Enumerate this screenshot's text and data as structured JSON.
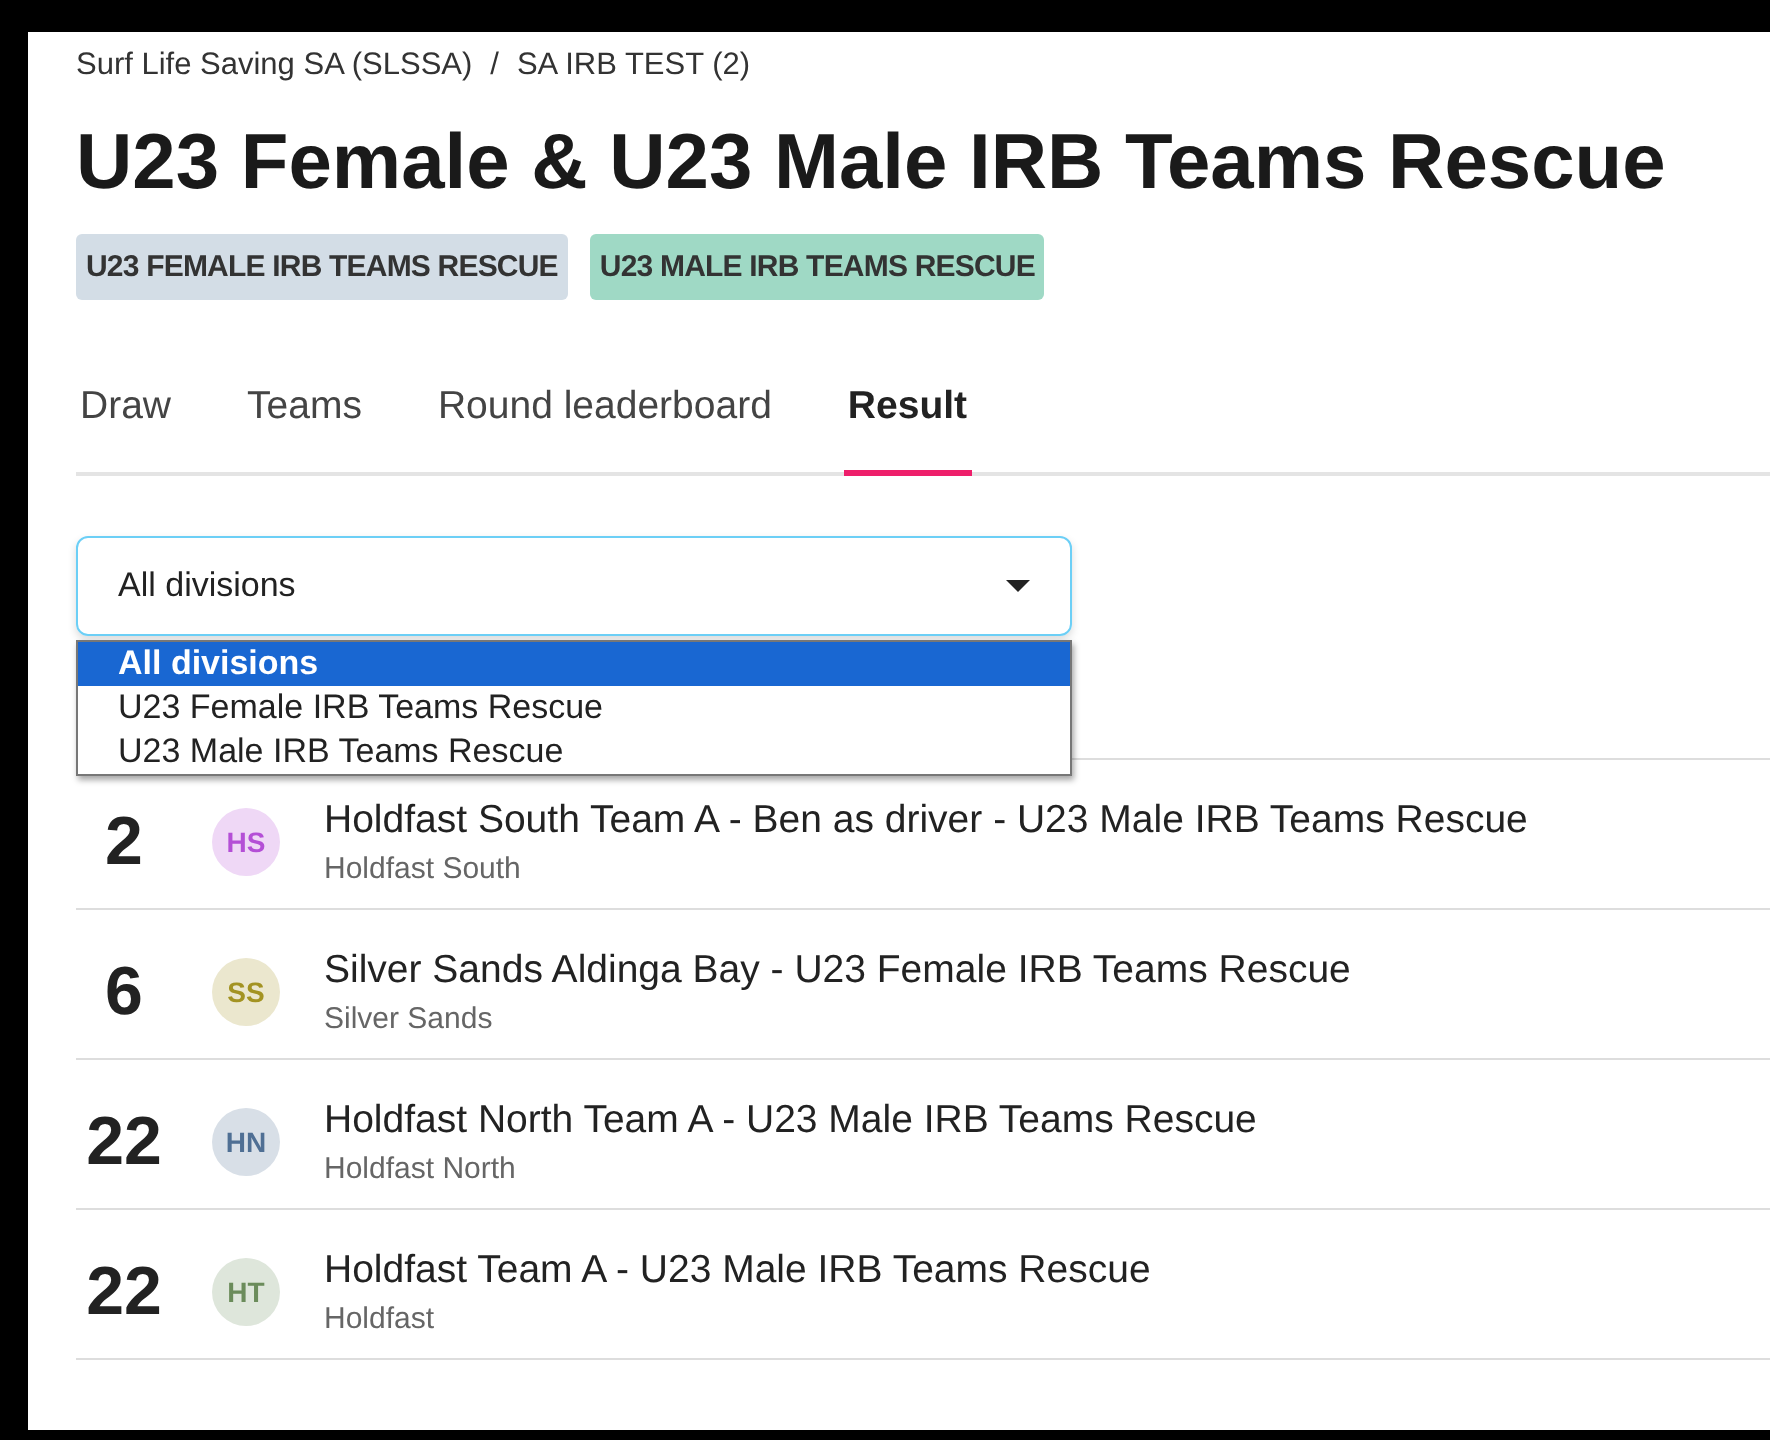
{
  "breadcrumb": [
    "Surf Life Saving SA (SLSSA)",
    "SA IRB TEST (2)"
  ],
  "breadcrumb_separator": "/",
  "title": "U23 Female & U23 Male IRB Teams Rescue",
  "chips": [
    {
      "label": "U23 FEMALE IRB TEAMS RESCUE",
      "color": "#d3dde6"
    },
    {
      "label": "U23 MALE IRB TEAMS RESCUE",
      "color": "#9fd9c5"
    }
  ],
  "tabs": [
    {
      "label": "Draw",
      "selected": false
    },
    {
      "label": "Teams",
      "selected": false
    },
    {
      "label": "Round leaderboard",
      "selected": false
    },
    {
      "label": "Result",
      "selected": true
    }
  ],
  "division_select": {
    "value": "All divisions",
    "expanded": true,
    "options": [
      {
        "label": "All divisions",
        "selected": true
      },
      {
        "label": "U23 Female IRB Teams Rescue",
        "selected": false
      },
      {
        "label": "U23 Male IRB Teams Rescue",
        "selected": false
      }
    ]
  },
  "results": [
    {
      "place": "2",
      "initials": "HS",
      "color": "#b44fd6",
      "team": "Holdfast South Team A - Ben as driver - U23 Male IRB Teams Rescue",
      "club": "Holdfast South"
    },
    {
      "place": "6",
      "initials": "SS",
      "color": "#a39322",
      "team": "Silver Sands Aldinga Bay - U23 Female IRB Teams Rescue",
      "club": "Silver Sands"
    },
    {
      "place": "22",
      "initials": "HN",
      "color": "#4f6f94",
      "team": "Holdfast North Team A - U23 Male IRB Teams Rescue",
      "club": "Holdfast North"
    },
    {
      "place": "22",
      "initials": "HT",
      "color": "#6b8c5b",
      "team": "Holdfast Team A - U23 Male IRB Teams Rescue",
      "club": "Holdfast"
    }
  ]
}
